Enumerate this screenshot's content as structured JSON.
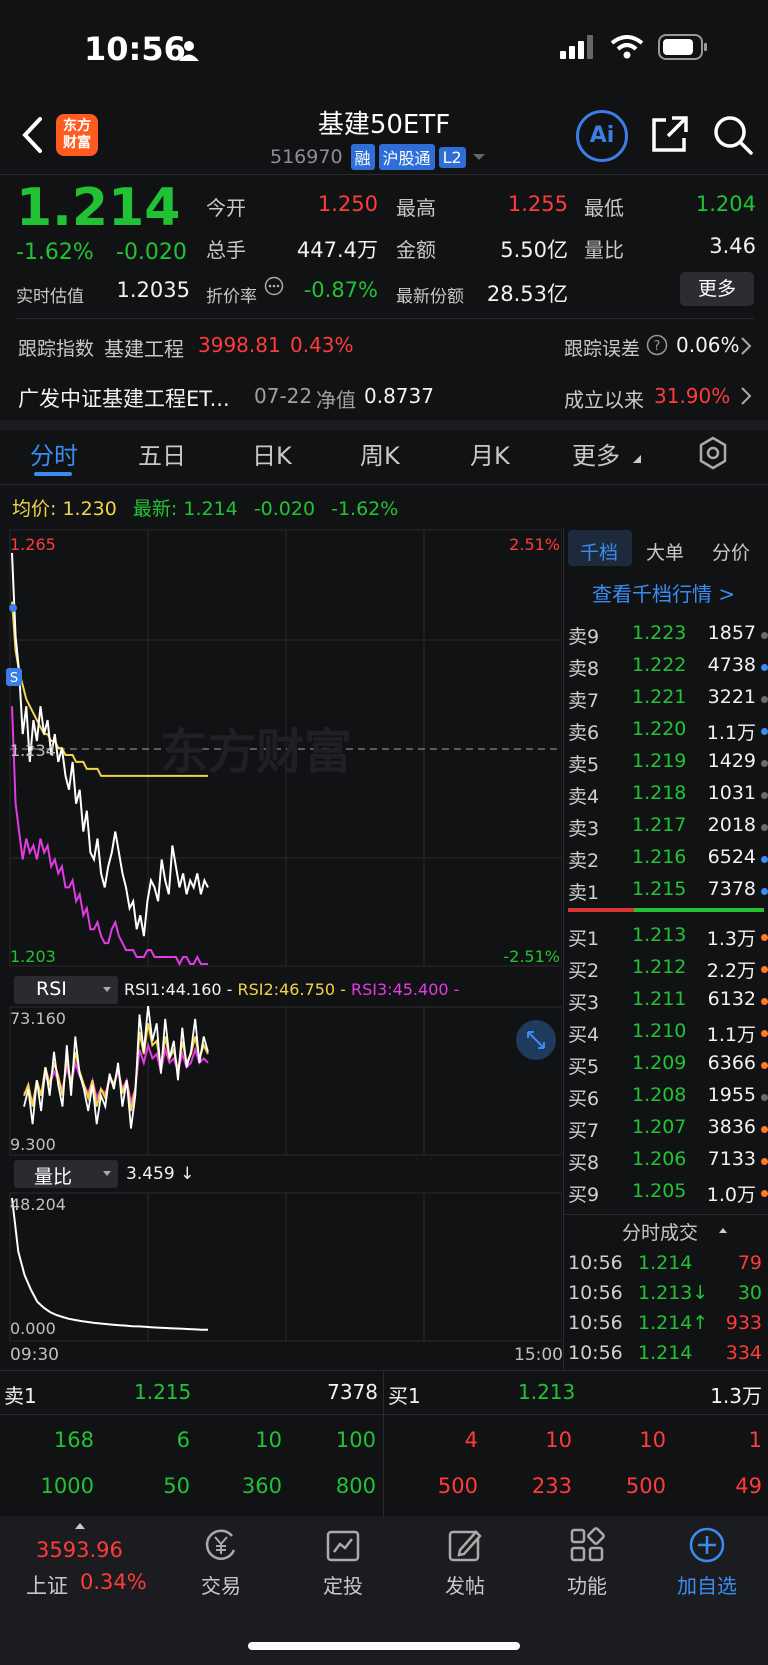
{
  "status": {
    "time": "10:56"
  },
  "header": {
    "logo_text_1": "东方",
    "logo_text_2": "财富",
    "title": "基建50ETF",
    "code": "516970",
    "tags": [
      "融",
      "沪股通",
      "L2"
    ],
    "ai_label": "Ai"
  },
  "quote": {
    "price": "1.214",
    "change_pct": "-1.62%",
    "change_amt": "-0.020",
    "open_label": "今开",
    "open": "1.250",
    "high_label": "最高",
    "high": "1.255",
    "low_label": "最低",
    "low": "1.204",
    "vol_label": "总手",
    "vol": "447.4万",
    "amount_label": "金额",
    "amount": "5.50亿",
    "ratio_label": "量比",
    "ratio": "3.46",
    "iopv_label": "实时估值",
    "iopv": "1.2035",
    "discount_label": "折价率",
    "discount": "-0.87%",
    "shares_label": "最新份额",
    "shares": "28.53亿",
    "more_label": "更多"
  },
  "tracking": {
    "label": "跟踪指数",
    "index_name": "基建工程",
    "index_value": "3998.81",
    "index_change": "0.43%",
    "error_label": "跟踪误差",
    "error_value": "0.06%"
  },
  "fund": {
    "name": "广发中证基建工程ET...",
    "nav_date": "07-22",
    "nav_label": "净值",
    "nav": "0.8737",
    "since_label": "成立以来",
    "since_value": "31.90%"
  },
  "tabs": [
    "分时",
    "五日",
    "日K",
    "周K",
    "月K",
    "更多"
  ],
  "legend": {
    "avg_label": "均价:",
    "avg": "1.230",
    "latest_label": "最新:",
    "latest": "1.214",
    "chg": "-0.020",
    "pct": "-1.62%"
  },
  "chart_data": [
    {
      "type": "line",
      "title": "",
      "y_top_label": "1.265",
      "y_bottom_label": "1.203",
      "y_mid_label": "1.234",
      "pct_top_label": "2.51%",
      "pct_bottom_label": "-2.51%",
      "ylim": [
        1.203,
        1.265
      ],
      "x_start_label": "09:30",
      "x_end_label": "15:00",
      "colors": {
        "price": "#ffffff",
        "avg": "#f1d448",
        "other": "#e23be4"
      },
      "price": [
        1.262,
        1.25,
        1.245,
        1.236,
        1.24,
        1.232,
        1.238,
        1.235,
        1.24,
        1.236,
        1.238,
        1.233,
        1.236,
        1.232,
        1.234,
        1.23,
        1.228,
        1.232,
        1.226,
        1.228,
        1.222,
        1.225,
        1.219,
        1.218,
        1.221,
        1.216,
        1.214,
        1.217,
        1.219,
        1.222,
        1.219,
        1.216,
        1.214,
        1.211,
        1.212,
        1.208,
        1.21,
        1.207,
        1.212,
        1.215,
        1.214,
        1.212,
        1.218,
        1.215,
        1.213,
        1.22,
        1.217,
        1.214,
        1.216,
        1.213,
        1.215,
        1.214,
        1.216,
        1.213,
        1.215,
        1.214
      ],
      "avg": [
        1.255,
        1.248,
        1.245,
        1.243,
        1.241,
        1.24,
        1.239,
        1.238,
        1.237,
        1.236,
        1.236,
        1.235,
        1.235,
        1.234,
        1.234,
        1.233,
        1.233,
        1.233,
        1.232,
        1.232,
        1.232,
        1.231,
        1.231,
        1.231,
        1.231,
        1.23,
        1.23,
        1.23,
        1.23,
        1.23,
        1.23,
        1.23,
        1.23,
        1.23,
        1.23,
        1.23,
        1.23,
        1.23,
        1.23,
        1.23,
        1.23,
        1.23,
        1.23,
        1.23,
        1.23,
        1.23,
        1.23,
        1.23,
        1.23,
        1.23,
        1.23,
        1.23,
        1.23,
        1.23,
        1.23,
        1.23
      ],
      "other": [
        1.24,
        1.226,
        1.222,
        1.218,
        1.221,
        1.219,
        1.22,
        1.218,
        1.221,
        1.219,
        1.22,
        1.217,
        1.218,
        1.216,
        1.217,
        1.214,
        1.214,
        1.215,
        1.212,
        1.213,
        1.21,
        1.211,
        1.208,
        1.208,
        1.209,
        1.207,
        1.206,
        1.206,
        1.208,
        1.209,
        1.207,
        1.206,
        1.205,
        1.205,
        1.205,
        1.204,
        1.204,
        1.204,
        1.205,
        1.205,
        1.204,
        1.204,
        1.204,
        1.204,
        1.204,
        1.204,
        1.204,
        1.203,
        1.204,
        1.204,
        1.203,
        1.203,
        1.204,
        1.203,
        1.203,
        1.203
      ]
    },
    {
      "type": "line",
      "title": "RSI",
      "rsi1_label": "RSI1:44.160",
      "rsi2_label": "RSI2:46.750",
      "rsi3_label": "RSI3:45.400",
      "y_top_label": "73.160",
      "y_bottom_label": "9.300",
      "ylim": [
        9.3,
        73.16
      ],
      "rsi1": [
        30,
        38,
        22,
        42,
        28,
        48,
        35,
        55,
        40,
        30,
        58,
        35,
        62,
        45,
        38,
        28,
        40,
        22,
        35,
        30,
        45,
        38,
        50,
        30,
        42,
        20,
        35,
        72,
        55,
        76,
        60,
        68,
        45,
        70,
        52,
        60,
        42,
        66,
        48,
        55,
        70,
        50,
        62,
        55
      ],
      "rsi2": [
        35,
        40,
        30,
        42,
        35,
        48,
        40,
        50,
        44,
        35,
        52,
        40,
        55,
        46,
        40,
        34,
        42,
        30,
        38,
        34,
        44,
        40,
        48,
        36,
        42,
        28,
        38,
        64,
        54,
        68,
        58,
        60,
        48,
        62,
        52,
        56,
        46,
        60,
        50,
        54,
        62,
        52,
        58,
        54
      ],
      "rsi3": [
        36,
        38,
        32,
        40,
        36,
        44,
        40,
        46,
        42,
        38,
        48,
        40,
        50,
        44,
        40,
        36,
        42,
        34,
        38,
        36,
        42,
        40,
        46,
        38,
        42,
        32,
        38,
        56,
        50,
        58,
        52,
        54,
        46,
        56,
        50,
        52,
        46,
        54,
        48,
        50,
        56,
        50,
        52,
        50
      ]
    },
    {
      "type": "line",
      "title": "量比",
      "value_label": "3.459 ↓",
      "y_top_label": "48.204",
      "y_bottom_label": "0.000",
      "ylim": [
        0,
        48.204
      ],
      "values": [
        48.2,
        30,
        22,
        17,
        13,
        11,
        9.5,
        8.5,
        7.8,
        7.2,
        6.8,
        6.4,
        6.1,
        5.8,
        5.6,
        5.4,
        5.2,
        5.0,
        4.9,
        4.7,
        4.6,
        4.5,
        4.3,
        4.2,
        4.1,
        4.0,
        3.9,
        3.8,
        3.7,
        3.6,
        3.5,
        3.459
      ]
    }
  ],
  "rsi_selector": "RSI",
  "vr_selector": "量比",
  "panel": {
    "tabs": [
      "千档",
      "大单",
      "分价"
    ],
    "link": "查看千档行情 >",
    "sell": [
      {
        "label": "卖9",
        "price": "1.223",
        "vol": "1857",
        "dot": "#6a6a6a"
      },
      {
        "label": "卖8",
        "price": "1.222",
        "vol": "4738",
        "dot": "#3b8cf0"
      },
      {
        "label": "卖7",
        "price": "1.221",
        "vol": "3221",
        "dot": "#6a6a6a"
      },
      {
        "label": "卖6",
        "price": "1.220",
        "vol": "1.1万",
        "dot": "#3b8cf0"
      },
      {
        "label": "卖5",
        "price": "1.219",
        "vol": "1429",
        "dot": "#6a6a6a"
      },
      {
        "label": "卖4",
        "price": "1.218",
        "vol": "1031",
        "dot": "#6a6a6a"
      },
      {
        "label": "卖3",
        "price": "1.217",
        "vol": "2018",
        "dot": "#6a6a6a"
      },
      {
        "label": "卖2",
        "price": "1.216",
        "vol": "6524",
        "dot": "#3b8cf0"
      },
      {
        "label": "卖1",
        "price": "1.215",
        "vol": "7378",
        "dot": "#3b8cf0"
      }
    ],
    "buy": [
      {
        "label": "买1",
        "price": "1.213",
        "vol": "1.3万",
        "dot": "#ff7a29"
      },
      {
        "label": "买2",
        "price": "1.212",
        "vol": "2.2万",
        "dot": "#ff7a29"
      },
      {
        "label": "买3",
        "price": "1.211",
        "vol": "6132",
        "dot": "#ff7a29"
      },
      {
        "label": "买4",
        "price": "1.210",
        "vol": "1.1万",
        "dot": "#ff7a29"
      },
      {
        "label": "买5",
        "price": "1.209",
        "vol": "6366",
        "dot": "#ff7a29"
      },
      {
        "label": "买6",
        "price": "1.208",
        "vol": "1955",
        "dot": "#6a6a6a"
      },
      {
        "label": "买7",
        "price": "1.207",
        "vol": "3836",
        "dot": "#ff7a29"
      },
      {
        "label": "买8",
        "price": "1.206",
        "vol": "7133",
        "dot": "#ff7a29"
      },
      {
        "label": "买9",
        "price": "1.205",
        "vol": "1.0万",
        "dot": "#ff7a29"
      }
    ],
    "trades_title": "分时成交",
    "trades": [
      {
        "time": "10:56",
        "price": "1.214",
        "vol": "79"
      },
      {
        "time": "10:56",
        "price": "1.213↓",
        "vol": "30"
      },
      {
        "time": "10:56",
        "price": "1.214↑",
        "vol": "933"
      },
      {
        "time": "10:56",
        "price": "1.214",
        "vol": "334"
      }
    ]
  },
  "bottom_book": {
    "sell_label": "卖1",
    "sell_price": "1.215",
    "sell_vol": "7378",
    "buy_label": "买1",
    "buy_price": "1.213",
    "buy_vol": "1.3万",
    "sell_row1": [
      "168",
      "6",
      "10",
      "100"
    ],
    "sell_row2": [
      "1000",
      "50",
      "360",
      "800"
    ],
    "buy_row1": [
      "4",
      "10",
      "10",
      "1"
    ],
    "buy_row2": [
      "500",
      "233",
      "500",
      "49"
    ]
  },
  "nav": {
    "index_value": "3593.96",
    "index_name": "上证",
    "index_change": "0.34%",
    "items": [
      "交易",
      "定投",
      "发帖",
      "功能",
      "加自选"
    ]
  },
  "watermark": "东方财富"
}
